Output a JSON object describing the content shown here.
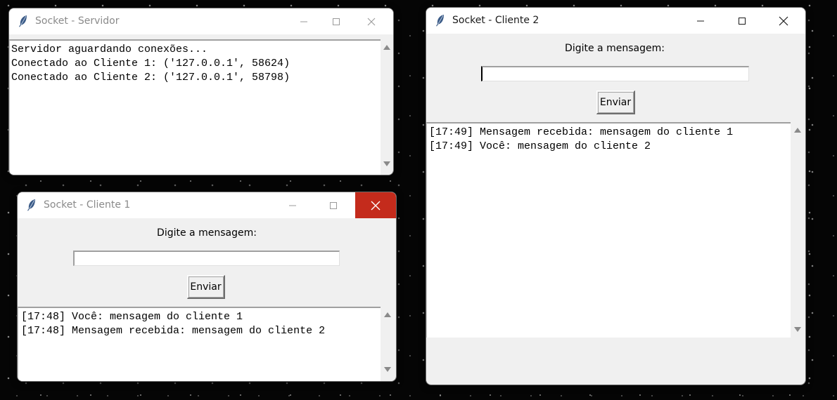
{
  "servidor": {
    "title": "Socket - Servidor",
    "log": [
      "Servidor aguardando conexões...",
      "Conectado ao Cliente 1: ('127.0.0.1', 58624)",
      "Conectado ao Cliente 2: ('127.0.0.1', 58798)"
    ]
  },
  "cliente1": {
    "title": "Socket - Cliente 1",
    "prompt": "Digite a mensagem:",
    "input_value": "",
    "send_label": "Enviar",
    "log": [
      "[17:48] Você: mensagem do cliente 1",
      "[17:48] Mensagem recebida: mensagem do cliente 2"
    ]
  },
  "cliente2": {
    "title": "Socket - Cliente 2",
    "prompt": "Digite a mensagem:",
    "input_value": "",
    "send_label": "Enviar",
    "log": [
      "[17:49] Mensagem recebida: mensagem do cliente 1",
      "[17:49] Você: mensagem do cliente 2"
    ]
  },
  "icons": {
    "app": "feather-icon",
    "minimize": "minimize-icon",
    "maximize": "maximize-icon",
    "close": "close-icon"
  },
  "colors": {
    "close_hover": "#c42b1c",
    "window_bg": "#f0f0f0"
  }
}
